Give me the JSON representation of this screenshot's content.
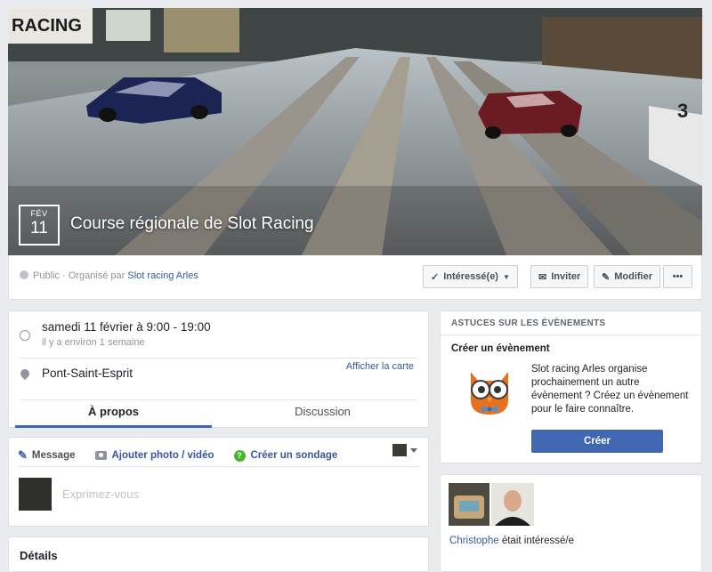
{
  "cover": {
    "month": "FÉV",
    "day": "11",
    "title": "Course régionale de Slot Racing"
  },
  "meta": {
    "prefix": "Public · Organisé par",
    "organizer": "Slot racing Arles",
    "buttons": {
      "interested": "Intéressé(e)",
      "invite": "Inviter",
      "edit": "Modifier",
      "more": "•••"
    }
  },
  "info": {
    "datetime": "samedi 11 février à 9:00 - 19:00",
    "relative": "il y a environ 1 semaine",
    "location": "Pont-Saint-Esprit",
    "map_link": "Afficher la carte",
    "tabs": [
      "À propos",
      "Discussion"
    ]
  },
  "composer": {
    "message": "Message",
    "add_photo": "Ajouter photo / vidéo",
    "poll": "Créer un sondage",
    "placeholder": "Exprimez-vous"
  },
  "details": {
    "title": "Détails"
  },
  "tips": {
    "header": "ASTUCES SUR LES ÉVÈNEMENTS",
    "subtitle": "Créer un évènement",
    "text": "Slot racing Arles organise prochainement un autre évènement ? Créez un évènement pour le faire connaître.",
    "button": "Créer"
  },
  "interested": {
    "name": "Christophe",
    "suffix": "était intéressé/e"
  }
}
